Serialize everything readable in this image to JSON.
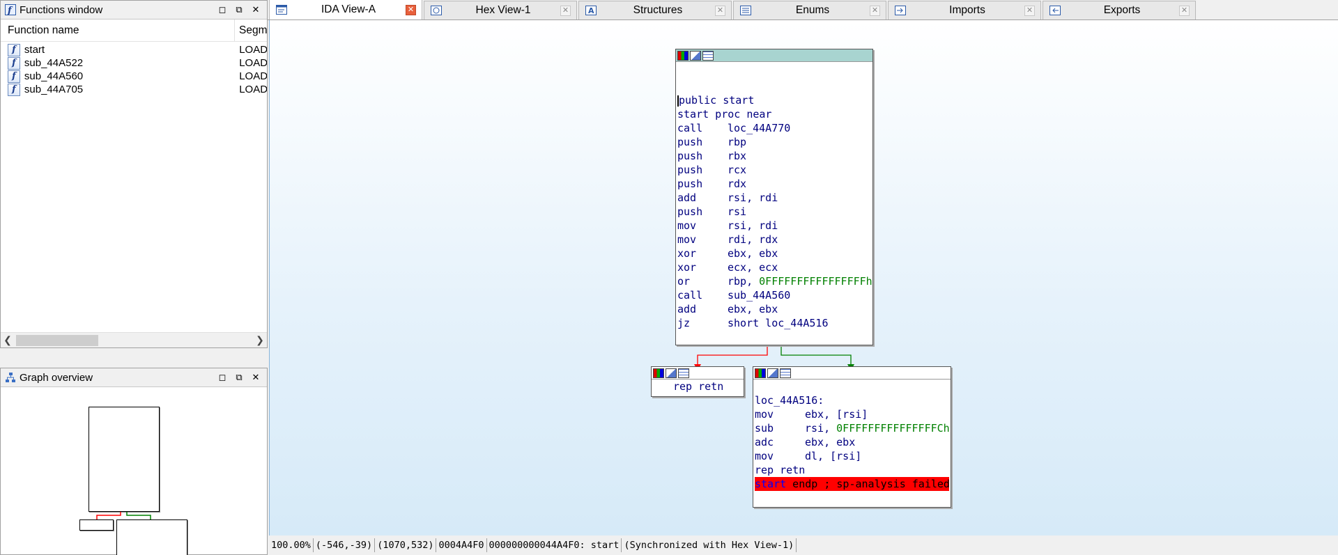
{
  "functions_window": {
    "title": "Functions window",
    "col_name": "Function name",
    "col_segment": "Segm",
    "rows": [
      {
        "name": "start",
        "segment": "LOAD"
      },
      {
        "name": "sub_44A522",
        "segment": "LOAD"
      },
      {
        "name": "sub_44A560",
        "segment": "LOAD"
      },
      {
        "name": "sub_44A705",
        "segment": "LOAD"
      }
    ]
  },
  "graph_overview": {
    "title": "Graph overview"
  },
  "tabs": [
    {
      "label": "IDA View-A",
      "icon": "ida-view-icon",
      "active": true
    },
    {
      "label": "Hex View-1",
      "icon": "hex-view-icon"
    },
    {
      "label": "Structures",
      "icon": "structures-icon"
    },
    {
      "label": "Enums",
      "icon": "enums-icon"
    },
    {
      "label": "Imports",
      "icon": "imports-icon"
    },
    {
      "label": "Exports",
      "icon": "exports-icon"
    }
  ],
  "graph": {
    "main_node": {
      "header_line1": "public start",
      "header_line2": "start proc near",
      "instructions": [
        {
          "mn": "call",
          "op": "loc_44A770"
        },
        {
          "mn": "push",
          "op": "rbp"
        },
        {
          "mn": "push",
          "op": "rbx"
        },
        {
          "mn": "push",
          "op": "rcx"
        },
        {
          "mn": "push",
          "op": "rdx"
        },
        {
          "mn": "add",
          "op": "rsi, rdi"
        },
        {
          "mn": "push",
          "op": "rsi"
        },
        {
          "mn": "mov",
          "op": "rsi, rdi"
        },
        {
          "mn": "mov",
          "op": "rdi, rdx"
        },
        {
          "mn": "xor",
          "op": "ebx, ebx"
        },
        {
          "mn": "xor",
          "op": "ecx, ecx"
        },
        {
          "mn": "or",
          "op": "rbp, ",
          "num": "0FFFFFFFFFFFFFFFFh"
        },
        {
          "mn": "call",
          "op": "sub_44A560"
        },
        {
          "mn": "add",
          "op": "ebx, ebx"
        },
        {
          "mn": "jz",
          "op": "short loc_44A516"
        }
      ]
    },
    "left_node": {
      "text": "rep retn"
    },
    "right_node": {
      "label": "loc_44A516:",
      "instructions": [
        {
          "mn": "mov",
          "op": "ebx, [rsi]"
        },
        {
          "mn": "sub",
          "op": "rsi, ",
          "num": "0FFFFFFFFFFFFFFFCh"
        },
        {
          "mn": "adc",
          "op": "ebx, ebx"
        },
        {
          "mn": "mov",
          "op": "dl, [rsi]"
        },
        {
          "mn": "rep retn",
          "op": ""
        }
      ],
      "end_kw": "start",
      "end_rest": " endp ; sp-analysis failed"
    },
    "edge_colors": {
      "false_branch": "#ff0000",
      "true_branch": "#008000"
    }
  },
  "statusbar": {
    "zoom": "100.00%",
    "offset": "(-546,-39)",
    "coords": "(1070,532)",
    "file_offset": "0004A4F0",
    "address": "000000000044A4F0: start",
    "sync": "(Synchronized with Hex View-1)"
  }
}
